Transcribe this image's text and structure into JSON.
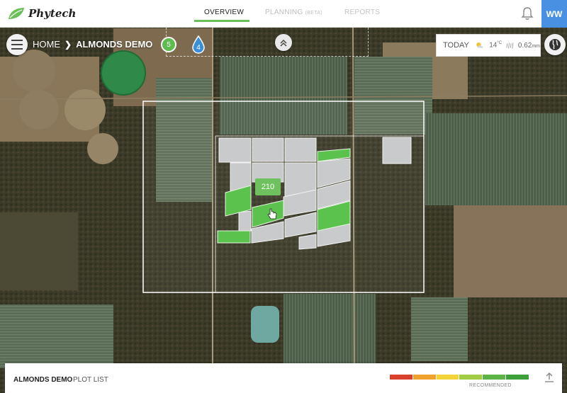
{
  "app": {
    "name": "Phytech"
  },
  "nav": {
    "tabs": [
      {
        "label": "OVERVIEW",
        "active": true
      },
      {
        "label": "PLANNING",
        "note": "(BETA)"
      },
      {
        "label": "REPORTS"
      }
    ]
  },
  "user": {
    "initials": "WW"
  },
  "breadcrumb": {
    "home": "HOME",
    "separator": "❯",
    "current": "ALMONDS DEMO"
  },
  "badges": {
    "green_count": "5",
    "blue_count": "4"
  },
  "weather": {
    "today_label": "TODAY",
    "icon": "partly-sunny-icon",
    "temp": "14",
    "temp_unit": "°C",
    "rain": "0.62",
    "rain_unit": "mm"
  },
  "map": {
    "plot_label": "210"
  },
  "bottom": {
    "title": "ALMONDS DEMO",
    "subtitle": "PLOT LIST",
    "scale_label": "RECOMMENDED",
    "scale_colors": [
      "#d9412c",
      "#f0a12b",
      "#f3d33a",
      "#a3cc45",
      "#5cb346",
      "#3ea03a"
    ],
    "scale_marker_fraction": 0.72
  },
  "colors": {
    "accent": "#6bbf59",
    "avatar": "#4a90e2"
  }
}
